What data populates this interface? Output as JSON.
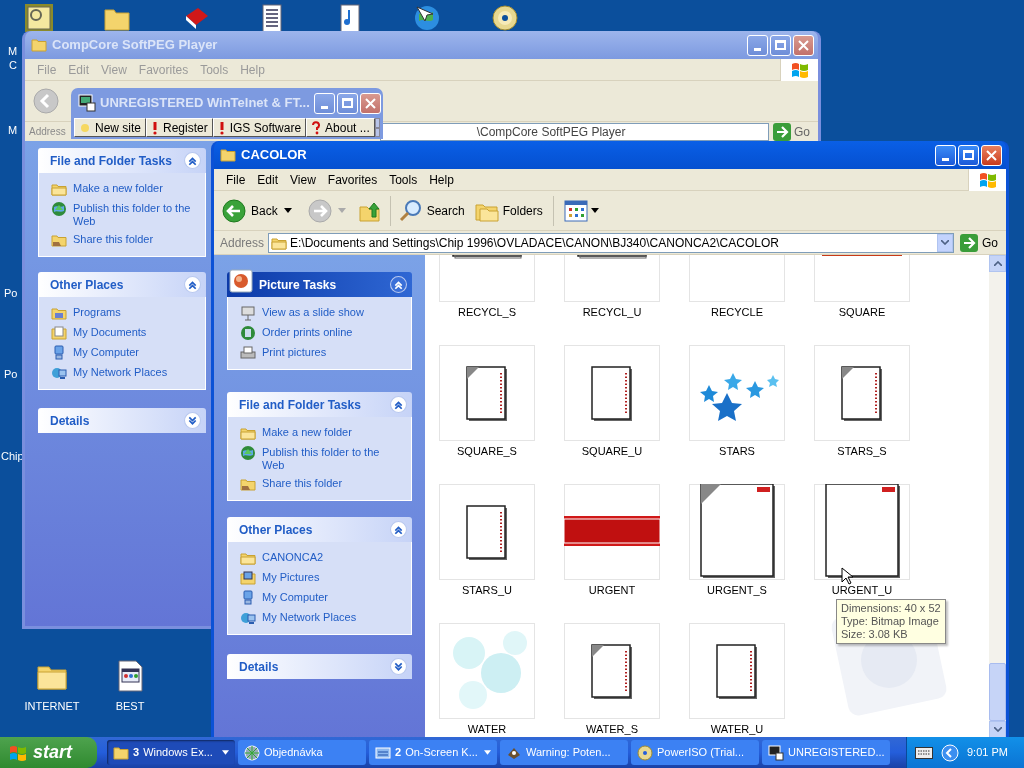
{
  "desktop": {
    "edge_labels": [
      "M",
      "C",
      "M",
      "Po",
      "Po",
      "Chip"
    ],
    "icons": [
      {
        "label": "INTERNET"
      },
      {
        "label": "BEST"
      }
    ]
  },
  "softpeg_window": {
    "title": "CompCore SoftPEG Player",
    "active": false,
    "menu": [
      "File",
      "Edit",
      "View",
      "Favorites",
      "Tools",
      "Help"
    ],
    "address_label": "Address",
    "address": "\\CompCore SoftPEG Player",
    "go": "Go",
    "sections": [
      {
        "kind": "plain",
        "title": "File and Folder Tasks",
        "expanded": true,
        "items": [
          "Make a new folder",
          "Publish this folder to the Web",
          "Share this folder"
        ]
      },
      {
        "kind": "plain",
        "title": "Other Places",
        "expanded": true,
        "items": [
          "Programs",
          "My Documents",
          "My Computer",
          "My Network Places"
        ]
      },
      {
        "kind": "plain",
        "title": "Details",
        "expanded": false
      }
    ]
  },
  "wintelnet_window": {
    "title": "UNREGISTERED WinTelnet & FT...",
    "active": false,
    "buttons": [
      "New site",
      "Register",
      "IGS Software",
      "About ..."
    ]
  },
  "cacolor_window": {
    "title": "CACOLOR",
    "active": true,
    "menu": [
      "File",
      "Edit",
      "View",
      "Favorites",
      "Tools",
      "Help"
    ],
    "toolbar": {
      "back": "Back",
      "search": "Search",
      "folders": "Folders"
    },
    "address_label": "Address",
    "address": "E:\\Documents and Settings\\Chip 1996\\OVLADACE\\CANON\\BJ340\\CANONCA2\\CACOLOR",
    "go": "Go",
    "sections": [
      {
        "kind": "special",
        "title": "Picture Tasks",
        "expanded": true,
        "items": [
          "View as a slide show",
          "Order prints online",
          "Print pictures"
        ]
      },
      {
        "kind": "plain",
        "title": "File and Folder Tasks",
        "expanded": true,
        "items": [
          "Make a new folder",
          "Publish this folder to the Web",
          "Share this folder"
        ]
      },
      {
        "kind": "plain",
        "title": "Other Places",
        "expanded": true,
        "items": [
          "CANONCA2",
          "My Pictures",
          "My Computer",
          "My Network Places"
        ]
      },
      {
        "kind": "plain",
        "title": "Details",
        "expanded": false
      }
    ],
    "files": [
      {
        "name": "RECYCL_S",
        "kind": "recycle"
      },
      {
        "name": "RECYCL_U",
        "kind": "recycle"
      },
      {
        "name": "RECYCLE",
        "kind": "recycle-band"
      },
      {
        "name": "SQUARE",
        "kind": "square"
      },
      {
        "name": "SQUARE_S",
        "kind": "page-ear"
      },
      {
        "name": "SQUARE_U",
        "kind": "page"
      },
      {
        "name": "STARS",
        "kind": "stars"
      },
      {
        "name": "STARS_S",
        "kind": "page-ear"
      },
      {
        "name": "STARS_U",
        "kind": "page"
      },
      {
        "name": "URGENT",
        "kind": "urgent"
      },
      {
        "name": "URGENT_S",
        "kind": "bigpage-ear"
      },
      {
        "name": "URGENT_U",
        "kind": "bigpage"
      },
      {
        "name": "WATER",
        "kind": "water"
      },
      {
        "name": "WATER_S",
        "kind": "page-ear"
      },
      {
        "name": "WATER_U",
        "kind": "page"
      }
    ],
    "tooltip": [
      "Dimensions: 40 x 52",
      "Type: Bitmap Image",
      "Size: 3.08 KB"
    ]
  },
  "taskbar": {
    "start": "start",
    "clock": "9:01 PM",
    "items": [
      {
        "count": "3",
        "label": "Windows Ex...",
        "grouped": true,
        "selected": true
      },
      {
        "label": "Objednávka",
        "grouped": false,
        "selected": false
      },
      {
        "count": "2",
        "label": "On-Screen K...",
        "grouped": true,
        "selected": false
      },
      {
        "label": "Warning: Poten...",
        "grouped": false,
        "selected": false
      },
      {
        "label": "PowerISO (Trial...",
        "grouped": false,
        "selected": false
      },
      {
        "label": "UNREGISTERED...",
        "grouped": false,
        "selected": false
      }
    ]
  }
}
